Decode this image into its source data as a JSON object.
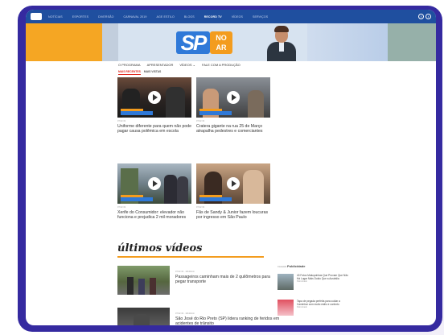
{
  "nav": {
    "items": [
      "NOTÍCIAS",
      "ESPORTES",
      "DIVERSÃO",
      "CARNAVAL 2019",
      "AGE ESTILO",
      "BLOGS",
      "RECORD TV",
      "VÍDEOS",
      "SERVIÇOS"
    ],
    "active": "RECORD TV"
  },
  "banner": {
    "sp": "SP",
    "no": "NO",
    "ar": "AR"
  },
  "subnav": [
    "O PROGRAMA",
    "APRESENTADOR",
    "VÍDEOS ⌄",
    "FALE COM A PRODUÇÃO"
  ],
  "tabs": {
    "recent": "MAIS RECENTES",
    "viewed": "MAIS VISTAS"
  },
  "cards": [
    {
      "date": "07.02.19",
      "title": "Uniforme diferente para quem não pode pagar causa polêmica em escola"
    },
    {
      "date": "07.02.19",
      "title": "Cratera gigante na rua 25 de Março atrapalha pedestres e comerciantes"
    },
    {
      "date": "07.02.19",
      "title": "Xerife do Consumidor: elevador não funciona e prejudica 2 mil moradores"
    },
    {
      "date": "07.02.19",
      "title": "Fãs de Sandy & Junior fazem loucuras por ingresso em São Paulo"
    }
  ],
  "ultimos": {
    "heading": "últimos vídeos",
    "items": [
      {
        "date": "07.02.19 · 14h13min",
        "title": "Passageiros caminham mais de 2 quilômetros para pegar transporte"
      },
      {
        "date": "07.02.19 · 14h13min",
        "title": "São José do Rio Preto (SP) lidera ranking de feridos em acidentes de trânsito"
      }
    ]
  },
  "sidebar": {
    "header_small": "Conteúdo",
    "header_big": "Publicidade",
    "items": [
      {
        "text": "40 Fotos Maluquinhas Que Provam Que Não Há Lugar Mais Doido Que a Austrália",
        "meta": "Patrocinado"
      },
      {
        "text": "Tapa de pegada perfeita para cuidar a Caminhar com muito estilo e conforto",
        "meta": "Patrocinado"
      }
    ]
  },
  "colors": {
    "frame": "#352aa0",
    "topbar": "#1f4f9f",
    "accent_orange": "#f39c1e",
    "accent_red": "#e0261d",
    "brand_blue": "#2f79d8"
  }
}
